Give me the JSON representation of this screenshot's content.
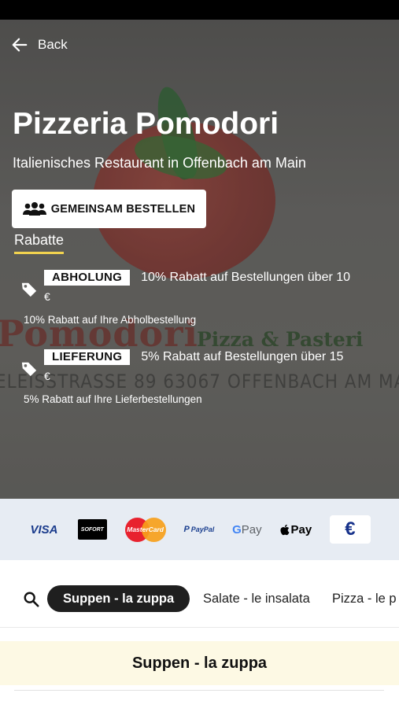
{
  "header": {
    "back_label": "Back"
  },
  "restaurant": {
    "name": "Pizzeria Pomodori",
    "subtitle": "Italienisches Restaurant in Offenbach am Main",
    "group_order_label": "GEMEINSAM BESTELLEN"
  },
  "tabs": {
    "rabatte_label": "Rabatte"
  },
  "background_logo": {
    "line1": "Pomodori",
    "line2": "Pizza & Pasteri",
    "line3": "ELEISSTRASSE 89   63067 OFFENBACH AM MAIN"
  },
  "discounts": [
    {
      "badge": "ABHOLUNG",
      "headline": "10% Rabatt auf Bestellungen über 10",
      "currency": "€",
      "detail": "10% Rabatt auf Ihre Abholbestellung"
    },
    {
      "badge": "LIEFERUNG",
      "headline": "5% Rabatt auf Bestellungen über 15",
      "currency": "€",
      "detail": "5% Rabatt auf Ihre Lieferbestellungen"
    }
  ],
  "payments": {
    "visa": "VISA",
    "sofort": "SOFORT",
    "mastercard": "MasterCard",
    "paypal": "PayPal",
    "gpay_g": "G",
    "gpay_pay": "Pay",
    "applepay": "Pay",
    "euro": "€"
  },
  "categories": {
    "active": "Suppen - la zuppa",
    "items": [
      "Salate - le insalata",
      "Pizza - le p"
    ]
  },
  "section": {
    "title": "Suppen - la zuppa"
  },
  "colors": {
    "accent_underline": "#f2d34f",
    "payment_bar": "#e7ecf3",
    "section_bg": "#fdf9e4",
    "active_pill": "#1f1f1f"
  }
}
